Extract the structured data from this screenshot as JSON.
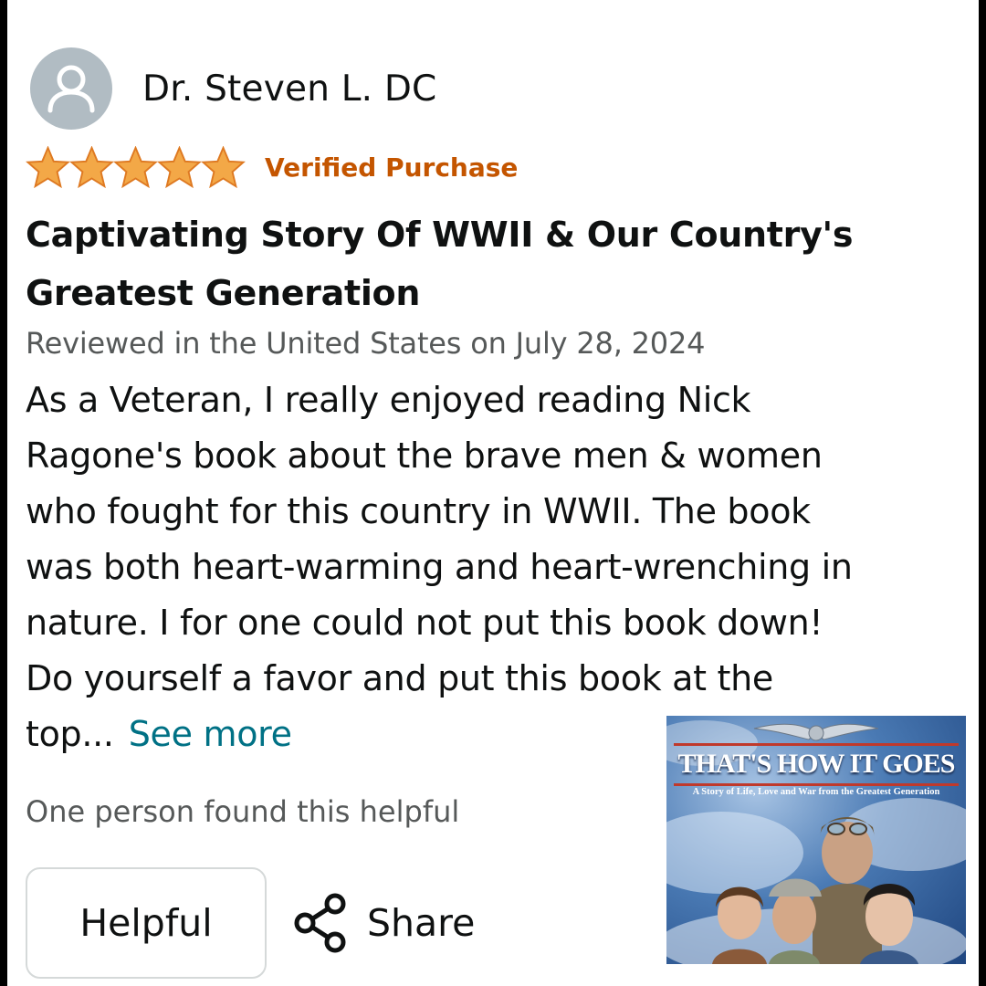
{
  "review": {
    "reviewer_name": "Dr. Steven L. DC",
    "avatar_icon": "user-silhouette-icon",
    "rating": 5,
    "rating_max": 5,
    "star_color": "#f3a847",
    "verified_label": "Verified Purchase",
    "verified_color": "#c45500",
    "title_line1": "Captivating Story Of WWII & Our Country's",
    "title_line2": "Greatest Generation",
    "date_text": "Reviewed in the United States on July 28, 2024",
    "body_lines": [
      "As a Veteran, I really enjoyed reading Nick",
      "Ragone's book about the brave men & women",
      "who fought for this country in WWII. The book",
      "was both heart-warming and heart-wrenching in",
      "nature. I for one could not put this book down!",
      "Do yourself a favor and put this book at the"
    ],
    "body_last": "top...",
    "see_more_label": "See more",
    "link_color": "#007185",
    "helpful_count_text": "One person found this helpful",
    "helpful_button_label": "Helpful",
    "share_label": "Share",
    "share_icon": "share-nodes-icon"
  },
  "book_cover": {
    "title": "THAT'S HOW IT GOES",
    "subtitle": "A Story of Life, Love and War from the Greatest Generation"
  }
}
